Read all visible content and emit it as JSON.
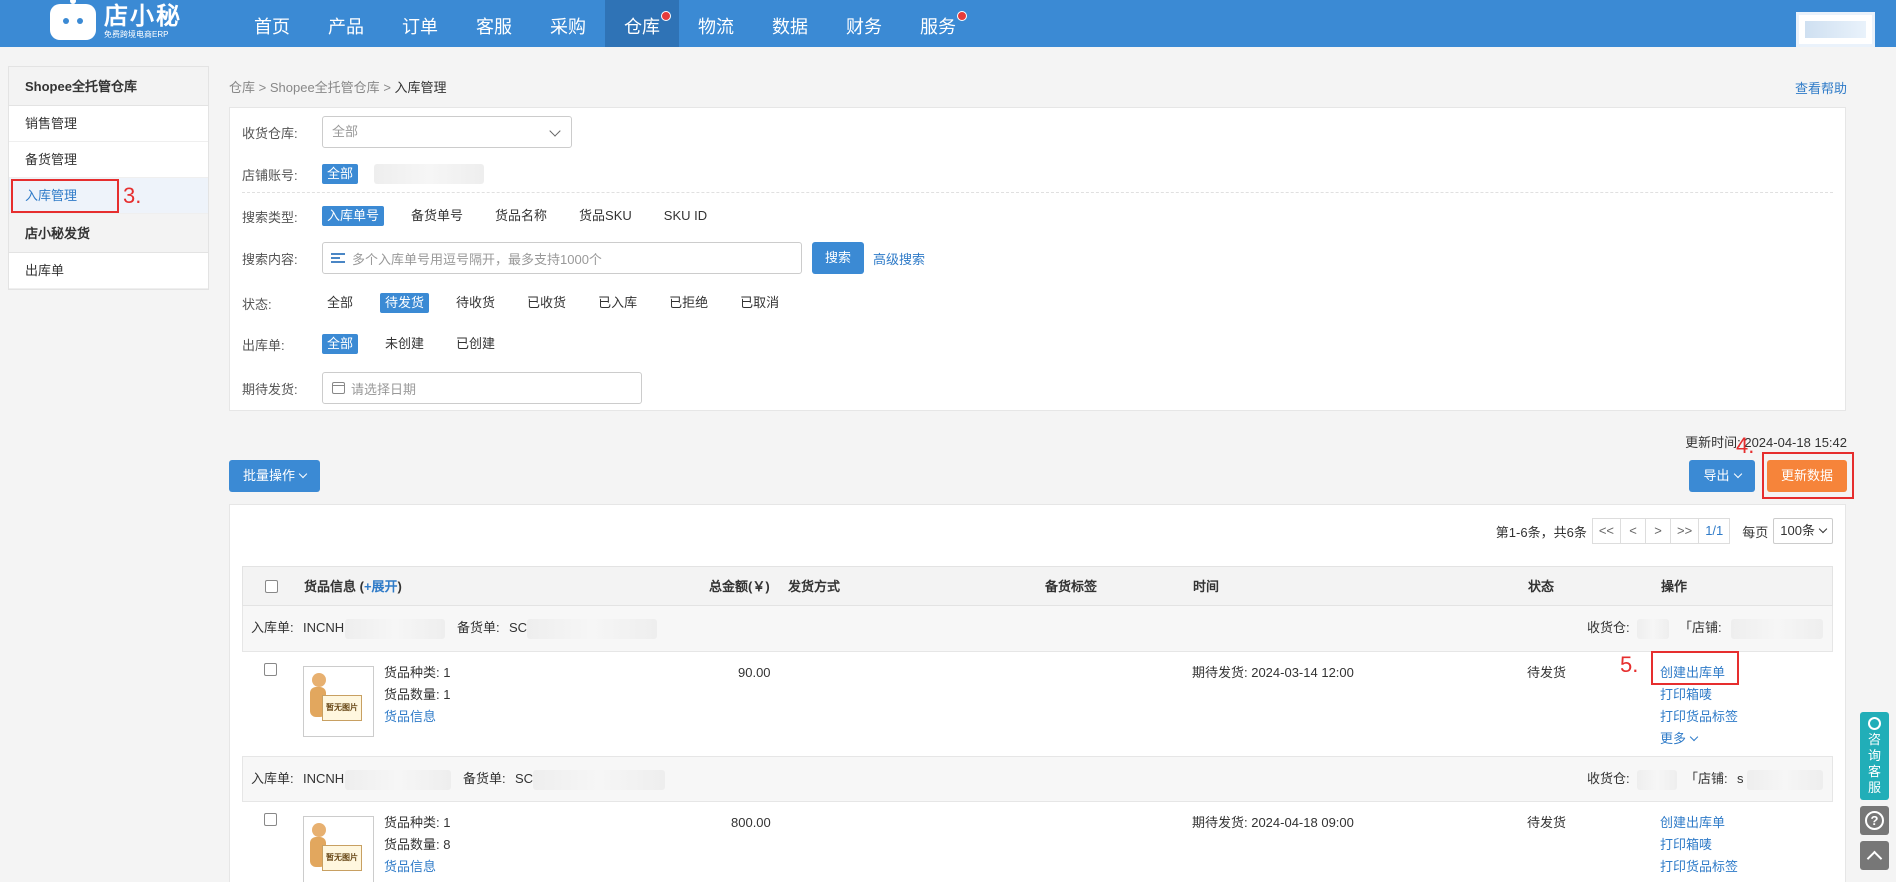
{
  "brand": {
    "name": "店小秘",
    "tagline": "免费跨境电商ERP"
  },
  "nav": {
    "items": [
      {
        "label": "首页"
      },
      {
        "label": "产品"
      },
      {
        "label": "订单"
      },
      {
        "label": "客服"
      },
      {
        "label": "采购"
      },
      {
        "label": "仓库"
      },
      {
        "label": "物流"
      },
      {
        "label": "数据"
      },
      {
        "label": "财务"
      },
      {
        "label": "服务"
      }
    ],
    "active": "仓库"
  },
  "sidebar": {
    "group1": "Shopee全托管仓库",
    "items1": [
      "销售管理",
      "备货管理",
      "入库管理"
    ],
    "group2": "店小秘发货",
    "items2": [
      "出库单"
    ]
  },
  "breadcrumb": {
    "a": "仓库",
    "b": "Shopee全托管仓库",
    "c": "入库管理",
    "sep": ">"
  },
  "help": "查看帮助",
  "filter": {
    "warehouse_label": "收货仓库:",
    "warehouse_value": "全部",
    "shop_label": "店铺账号:",
    "shop_all": "全部",
    "search_type_label": "搜索类型:",
    "search_types": [
      "入库单号",
      "备货单号",
      "货品名称",
      "货品SKU",
      "SKU ID"
    ],
    "search_content_label": "搜索内容:",
    "search_placeholder": "多个入库单号用逗号隔开，最多支持1000个",
    "search_btn": "搜索",
    "advanced": "高级搜索",
    "status_label": "状态:",
    "statuses": [
      "全部",
      "待发货",
      "待收货",
      "已收货",
      "已入库",
      "已拒绝",
      "已取消"
    ],
    "outbound_label": "出库单:",
    "outbound_opts": [
      "全部",
      "未创建",
      "已创建"
    ],
    "expected_label": "期待发货:",
    "date_placeholder": "请选择日期"
  },
  "toolbar": {
    "update_time": "更新时间: 2024-04-18 15:42",
    "batch": "批量操作",
    "export": "导出",
    "refresh": "更新数据"
  },
  "pager": {
    "summary": "第1-6条，共6条",
    "first": "<<",
    "prev": "<",
    "next": ">",
    "last": ">>",
    "page": "1/1",
    "per_label": "每页",
    "per_value": "100条"
  },
  "table": {
    "headers": {
      "goods": "货品信息 (",
      "expand": "+展开",
      "close": ")",
      "amount": "总金额(￥)",
      "ship": "发货方式",
      "tag": "备货标签",
      "time": "时间",
      "status": "状态",
      "ops": "操作"
    },
    "group_labels": {
      "inbound": "入库单:",
      "stock": "备货单:",
      "warehouse": "收货仓:",
      "shop": "「店铺:"
    },
    "rows": [
      {
        "inbound_prefix": "INCNH",
        "stock_prefix": "SC",
        "warehouse_end": "",
        "shop_prefix": "",
        "kinds": "货品种类: 1",
        "qty": "货品数量: 1",
        "info_link": "货品信息",
        "amount": "90.00",
        "time": "期待发货: 2024-03-14 12:00",
        "status": "待发货",
        "ops": [
          "创建出库单",
          "打印箱唛",
          "打印货品标签",
          "更多"
        ]
      },
      {
        "inbound_prefix": "INCNH",
        "stock_prefix": "SC",
        "warehouse_end": "",
        "shop_prefix": "s",
        "kinds": "货品种类: 1",
        "qty": "货品数量: 8",
        "info_link": "货品信息",
        "amount": "800.00",
        "time": "期待发货: 2024-04-18 09:00",
        "status": "待发货",
        "ops": [
          "创建出库单",
          "打印箱唛",
          "打印货品标签"
        ]
      }
    ],
    "no_image": "暂无图片"
  },
  "annotations": {
    "a3": "3.",
    "a4": "4.",
    "a5": "5."
  },
  "float": {
    "service": "咨询客服",
    "help": "?"
  },
  "colors": {
    "primary": "#3b8ad4",
    "accent_orange": "#f6843a",
    "annotation_red": "#e62e2e",
    "service_teal": "#21aeb8"
  }
}
